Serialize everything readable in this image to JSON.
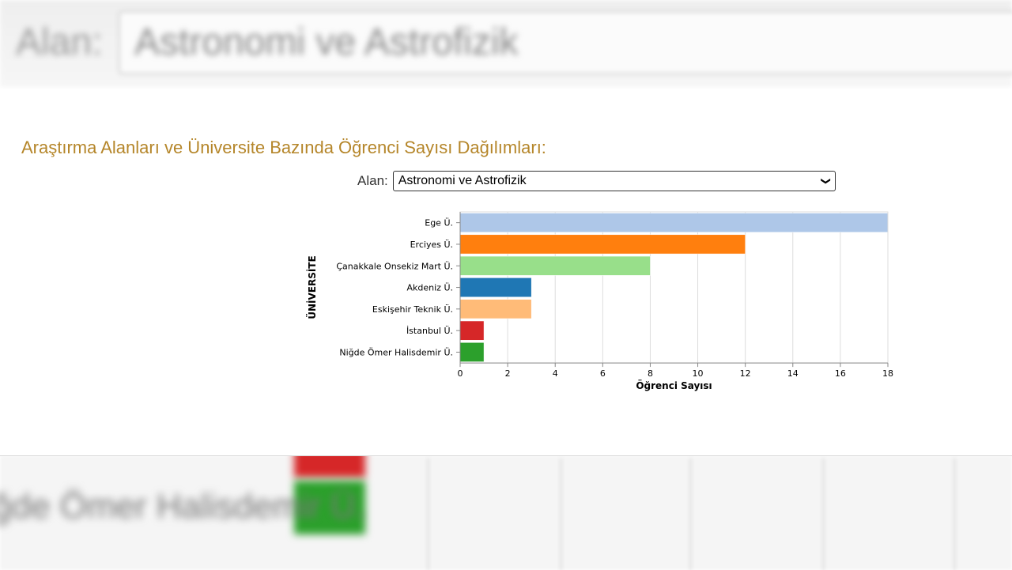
{
  "background": {
    "top_label": "Alan:",
    "top_field_text": "Astronomi ve Astrofizik",
    "bottom_text": "ğde Ömer Halisdemir Ü."
  },
  "section": {
    "title": "Araştırma Alanları ve Üniversite Bazında Öğrenci Sayısı Dağılımları:"
  },
  "filter": {
    "label": "Alan:",
    "selected": "Astronomi ve Astrofizik"
  },
  "chart_data": {
    "type": "bar",
    "orientation": "horizontal",
    "categories": [
      "Ege Ü.",
      "Erciyes Ü.",
      "Çanakkale Onsekiz Mart Ü.",
      "Akdeniz Ü.",
      "Eskişehir Teknik Ü.",
      "İstanbul Ü.",
      "Niğde Ömer Halisdemir Ü."
    ],
    "values": [
      18,
      12,
      8,
      3,
      3,
      1,
      1
    ],
    "colors": [
      "#aec7e8",
      "#ff7f0e",
      "#98df8a",
      "#1f77b4",
      "#ffbb78",
      "#d62728",
      "#2ca02c"
    ],
    "xlabel": "Öğrenci Sayısı",
    "ylabel": "ÜNİVERSİTE",
    "xlim": [
      0,
      18
    ],
    "xticks": [
      0,
      2,
      4,
      6,
      8,
      10,
      12,
      14,
      16,
      18
    ],
    "grid": true
  }
}
